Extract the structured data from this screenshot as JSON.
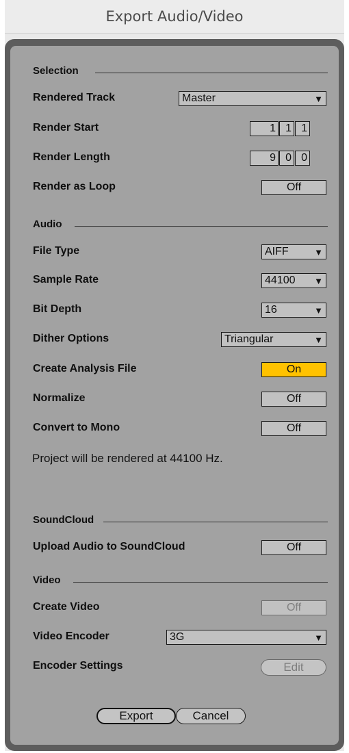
{
  "window": {
    "title": "Export Audio/Video"
  },
  "selection": {
    "heading": "Selection",
    "rendered_track": {
      "label": "Rendered Track",
      "value": "Master"
    },
    "render_start": {
      "label": "Render Start",
      "values": [
        "1",
        "1",
        "1"
      ]
    },
    "render_length": {
      "label": "Render Length",
      "values": [
        "9",
        "0",
        "0"
      ]
    },
    "render_as_loop": {
      "label": "Render as Loop",
      "value": "Off"
    }
  },
  "audio": {
    "heading": "Audio",
    "file_type": {
      "label": "File Type",
      "value": "AIFF"
    },
    "sample_rate": {
      "label": "Sample Rate",
      "value": "44100"
    },
    "bit_depth": {
      "label": "Bit Depth",
      "value": "16"
    },
    "dither_options": {
      "label": "Dither Options",
      "value": "Triangular"
    },
    "create_analysis_file": {
      "label": "Create Analysis File",
      "value": "On"
    },
    "normalize": {
      "label": "Normalize",
      "value": "Off"
    },
    "convert_to_mono": {
      "label": "Convert to Mono",
      "value": "Off"
    },
    "info": "Project will be rendered at 44100 Hz."
  },
  "soundcloud": {
    "heading": "SoundCloud",
    "upload": {
      "label": "Upload Audio to SoundCloud",
      "value": "Off"
    }
  },
  "video": {
    "heading": "Video",
    "create_video": {
      "label": "Create Video",
      "value": "Off"
    },
    "video_encoder": {
      "label": "Video Encoder",
      "value": "3G"
    },
    "encoder_settings": {
      "label": "Encoder Settings",
      "button": "Edit"
    }
  },
  "footer": {
    "export_label": "Export",
    "cancel_label": "Cancel"
  },
  "colors": {
    "toggle_on": "#ffc200",
    "panel_bg": "#a2a2a2",
    "frame_bg": "#5d5d5d"
  },
  "icons": {
    "dropdown": "triangle-down-icon"
  }
}
